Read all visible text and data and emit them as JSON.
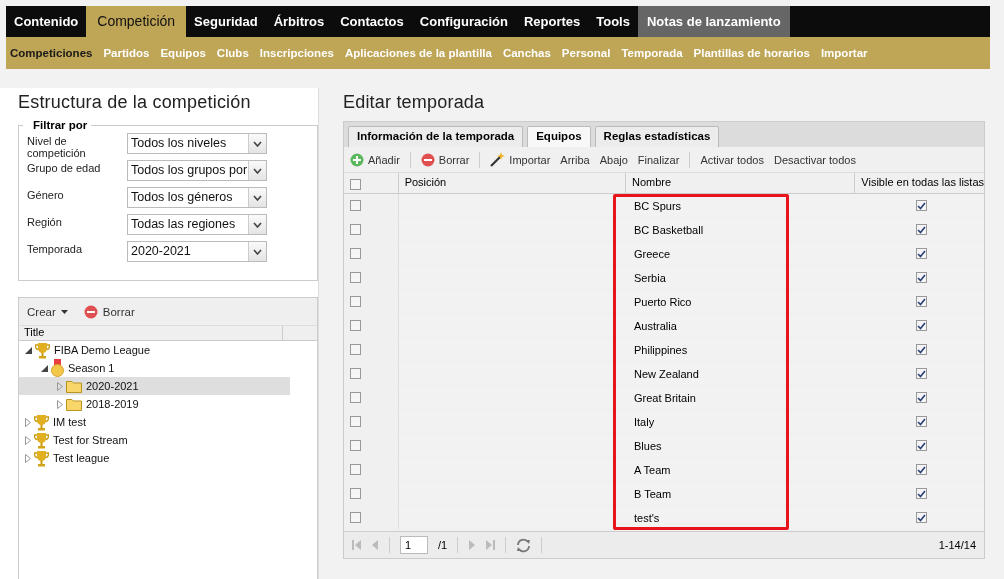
{
  "main_nav": [
    {
      "label": "Contenido",
      "selected": false,
      "kind": "normal"
    },
    {
      "label": "Competición",
      "selected": true,
      "kind": "normal"
    },
    {
      "label": "Seguridad",
      "selected": false,
      "kind": "normal"
    },
    {
      "label": "Árbitros",
      "selected": false,
      "kind": "normal"
    },
    {
      "label": "Contactos",
      "selected": false,
      "kind": "normal"
    },
    {
      "label": "Configuración",
      "selected": false,
      "kind": "normal"
    },
    {
      "label": "Reportes",
      "selected": false,
      "kind": "normal"
    },
    {
      "label": "Tools",
      "selected": false,
      "kind": "normal"
    },
    {
      "label": "Notas de lanzamiento",
      "selected": false,
      "kind": "release"
    }
  ],
  "sub_nav": [
    {
      "label": "Competiciones",
      "selected": true
    },
    {
      "label": "Partidos",
      "selected": false
    },
    {
      "label": "Equipos",
      "selected": false
    },
    {
      "label": "Clubs",
      "selected": false
    },
    {
      "label": "Inscripciones",
      "selected": false
    },
    {
      "label": "Aplicaciones de la plantilla",
      "selected": false
    },
    {
      "label": "Canchas",
      "selected": false
    },
    {
      "label": "Personal",
      "selected": false
    },
    {
      "label": "Temporada",
      "selected": false
    },
    {
      "label": "Plantillas de horarios",
      "selected": false
    },
    {
      "label": "Importar",
      "selected": false
    }
  ],
  "left_panel": {
    "title": "Estructura de la competición",
    "filter": {
      "legend": "Filtrar por",
      "fields": [
        {
          "label": "Nivel de competición",
          "value": "Todos los niveles"
        },
        {
          "label": "Grupo de edad",
          "value": "Todos los grupos por"
        },
        {
          "label": "Género",
          "value": "Todos los géneros"
        },
        {
          "label": "Región",
          "value": "Todas las regiones"
        },
        {
          "label": "Temporada",
          "value": "2020-2021"
        }
      ]
    },
    "toolbar": {
      "create": "Crear",
      "delete": "Borrar"
    },
    "tree_header": "Title",
    "tree": [
      {
        "label": "FIBA Demo League",
        "kind": "trophy",
        "expanded": true,
        "selected": false,
        "children": [
          {
            "label": "Season 1",
            "kind": "medal",
            "expanded": true,
            "selected": false,
            "children": [
              {
                "label": "2020-2021",
                "kind": "folder",
                "expanded": false,
                "selected": true
              },
              {
                "label": "2018-2019",
                "kind": "folder",
                "expanded": false,
                "selected": false
              }
            ]
          }
        ]
      },
      {
        "label": "IM test",
        "kind": "trophy",
        "expanded": false,
        "selected": false
      },
      {
        "label": "Test for Stream",
        "kind": "trophy",
        "expanded": false,
        "selected": false
      },
      {
        "label": "Test league",
        "kind": "trophy",
        "expanded": false,
        "selected": false
      }
    ]
  },
  "right_panel": {
    "title": "Editar temporada",
    "tabs": [
      {
        "label": "Información de la temporada",
        "selected": false
      },
      {
        "label": "Equipos",
        "selected": true
      },
      {
        "label": "Reglas estadísticas",
        "selected": false
      }
    ],
    "toolbar": [
      {
        "label": "Añadir",
        "kind": "add"
      },
      {
        "label": "Borrar",
        "kind": "delete"
      },
      {
        "label": "Importar",
        "kind": "import"
      },
      {
        "label": "Arriba",
        "kind": "plain"
      },
      {
        "label": "Abajo",
        "kind": "plain"
      },
      {
        "label": "Finalizar",
        "kind": "plain"
      },
      {
        "label": "Activar todos",
        "kind": "plain"
      },
      {
        "label": "Desactivar todos",
        "kind": "plain"
      }
    ],
    "select_all": {
      "selected": false
    },
    "columns": [
      "Posición",
      "Nombre",
      "Visible en todas las listas"
    ],
    "rows": [
      {
        "name": "BC Spurs",
        "selected": false,
        "visible": true
      },
      {
        "name": "BC Basketball",
        "selected": false,
        "visible": true
      },
      {
        "name": "Greece",
        "selected": false,
        "visible": true
      },
      {
        "name": "Serbia",
        "selected": false,
        "visible": true
      },
      {
        "name": "Puerto Rico",
        "selected": false,
        "visible": true
      },
      {
        "name": "Australia",
        "selected": false,
        "visible": true
      },
      {
        "name": "Philippines",
        "selected": false,
        "visible": true
      },
      {
        "name": "New Zealand",
        "selected": false,
        "visible": true
      },
      {
        "name": "Great Britain",
        "selected": false,
        "visible": true
      },
      {
        "name": "Italy",
        "selected": false,
        "visible": true
      },
      {
        "name": "Blues",
        "selected": false,
        "visible": true
      },
      {
        "name": "A Team",
        "selected": false,
        "visible": true
      },
      {
        "name": "B Team",
        "selected": false,
        "visible": true
      },
      {
        "name": "test's",
        "selected": false,
        "visible": true
      }
    ],
    "pager": {
      "page": "1",
      "total": "/1",
      "range": "1-14/14"
    }
  }
}
